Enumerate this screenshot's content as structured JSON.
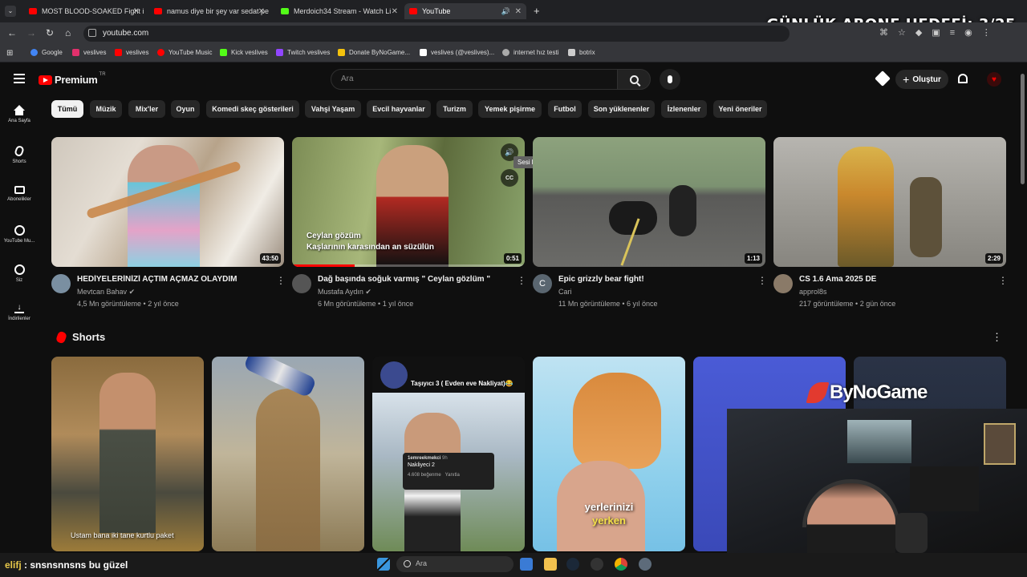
{
  "browser": {
    "tabs": [
      {
        "title": "MOST BLOOD-SOAKED Fight in",
        "color": "#ff0000"
      },
      {
        "title": "namus diye bir şey var sedat pe",
        "color": "#ff0000"
      },
      {
        "title": "Merdoich34 Stream - Watch Li",
        "color": "#53fc18"
      },
      {
        "title": "YouTube",
        "color": "#ff0000"
      }
    ],
    "new_tab": "+",
    "url": "youtube.com",
    "bookmarks": [
      {
        "label": "Google",
        "color": "#4285f4"
      },
      {
        "label": "veslives",
        "color": "#e1306c"
      },
      {
        "label": "veslives",
        "color": "#ff0000"
      },
      {
        "label": "YouTube Music",
        "color": "#ff0000"
      },
      {
        "label": "Kick veslives",
        "color": "#53fc18"
      },
      {
        "label": "Twitch veslives",
        "color": "#9146ff"
      },
      {
        "label": "Donate ByNoGame...",
        "color": "#f4c20d"
      },
      {
        "label": "veslives (@veslives)...",
        "color": "#ffffff"
      },
      {
        "label": "internet hız testi",
        "color": "#aaaaaa"
      },
      {
        "label": "botrix",
        "color": "#cccccc"
      }
    ]
  },
  "overlay": {
    "title": "GÜNLÜK ABONE HEDEFİ: 3/25",
    "brand": "ByNoGame"
  },
  "header": {
    "logo": "Premium",
    "logo_sup": "TR",
    "search_placeholder": "Ara",
    "create_label": "Oluştur"
  },
  "sidebar": [
    {
      "label": "Ana Sayfa",
      "icon": "home-icon"
    },
    {
      "label": "Shorts",
      "icon": "shorts-icon"
    },
    {
      "label": "Abonelikler",
      "icon": "subscriptions-icon"
    },
    {
      "label": "YouTube Mu...",
      "icon": "music-icon"
    },
    {
      "label": "Siz",
      "icon": "you-icon"
    },
    {
      "label": "İndirilenler",
      "icon": "download-icon"
    }
  ],
  "chips": [
    "Tümü",
    "Müzik",
    "Mix'ler",
    "Oyun",
    "Komedi skeç gösterileri",
    "Vahşi Yaşam",
    "Evcil hayvanlar",
    "Turizm",
    "Yemek pişirme",
    "Futbol",
    "Son yüklenenler",
    "İzlenenler",
    "Yeni öneriler"
  ],
  "videos": [
    {
      "title": "HEDİYELERİNİZİ AÇTIM AÇMAZ OLAYDIM",
      "channel": "Mevtcan Bahav",
      "verified": true,
      "meta": "4,5 Mn görüntüleme • 2 yıl önce",
      "duration": "43:50"
    },
    {
      "title": "Dağ başında soğuk varmış \" Ceylan gözlüm \"",
      "channel": "Mustafa Aydın",
      "verified": true,
      "meta": "6 Mn görüntüleme • 1 yıl önce",
      "duration": "0:51",
      "caption1": "Ceylan gözüm",
      "caption2": "Kaşlarının karasından an süzülün",
      "tooltip": "Sesi kapat"
    },
    {
      "title": "Epic grizzly bear fight!",
      "channel": "Cari",
      "verified": false,
      "meta": "11 Mn görüntüleme • 6 yıl önce",
      "duration": "1:13",
      "avatar_letter": "C"
    },
    {
      "title": "CS 1.6 Ama 2025 DE",
      "channel": "approl8s",
      "verified": false,
      "meta": "217 görüntüleme • 2 gün önce",
      "duration": "2:29"
    }
  ],
  "shorts_section": {
    "title": "Shorts"
  },
  "shorts": [
    {
      "caption": "Ustam bana iki tane kurtlu paket"
    },
    {
      "caption": ""
    },
    {
      "caption": "Taşıyıcı 3 ( Evden eve Nakliyat)😂",
      "comment_user": "1emreekmekci",
      "comment_time": "9h",
      "comment_text": "Nakliyeci 2",
      "comment_likes": "4.608 beğenme",
      "comment_reply": "Yanıtla"
    },
    {
      "caption1": "yerlerinizi",
      "caption2": "yerken"
    }
  ],
  "chat": {
    "user": "elifj",
    "message": " : snsnsnnsns bu güzel"
  },
  "taskbar": {
    "search_placeholder": "Ara"
  }
}
